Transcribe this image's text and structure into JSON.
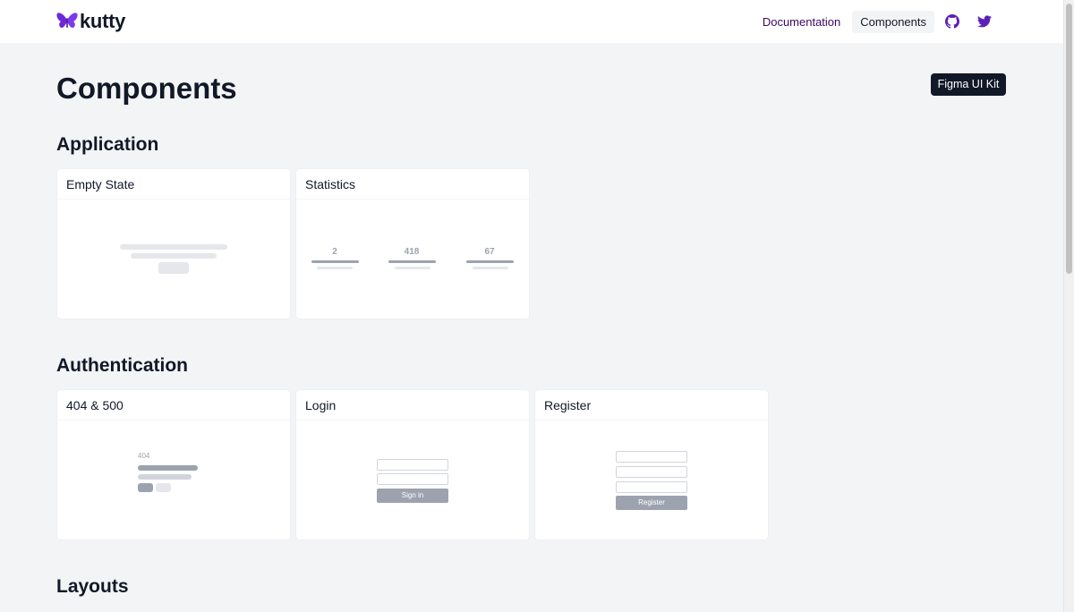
{
  "header": {
    "logo_text": "kutty",
    "nav": {
      "documentation": "Documentation",
      "components": "Components"
    },
    "icons": [
      "github-icon",
      "twitter-icon"
    ],
    "brand_color": "#6d28d9"
  },
  "page": {
    "title": "Components",
    "figma_button": "Figma UI Kit"
  },
  "sections": {
    "application": {
      "title": "Application",
      "cards": {
        "empty_state": {
          "title": "Empty State"
        },
        "statistics": {
          "title": "Statistics",
          "values": [
            "2",
            "418",
            "67"
          ]
        }
      }
    },
    "authentication": {
      "title": "Authentication",
      "cards": {
        "errors": {
          "title": "404 & 500",
          "code": "404"
        },
        "login": {
          "title": "Login",
          "button": "Sign in"
        },
        "register": {
          "title": "Register",
          "button": "Register"
        }
      }
    },
    "layouts": {
      "title": "Layouts"
    }
  }
}
